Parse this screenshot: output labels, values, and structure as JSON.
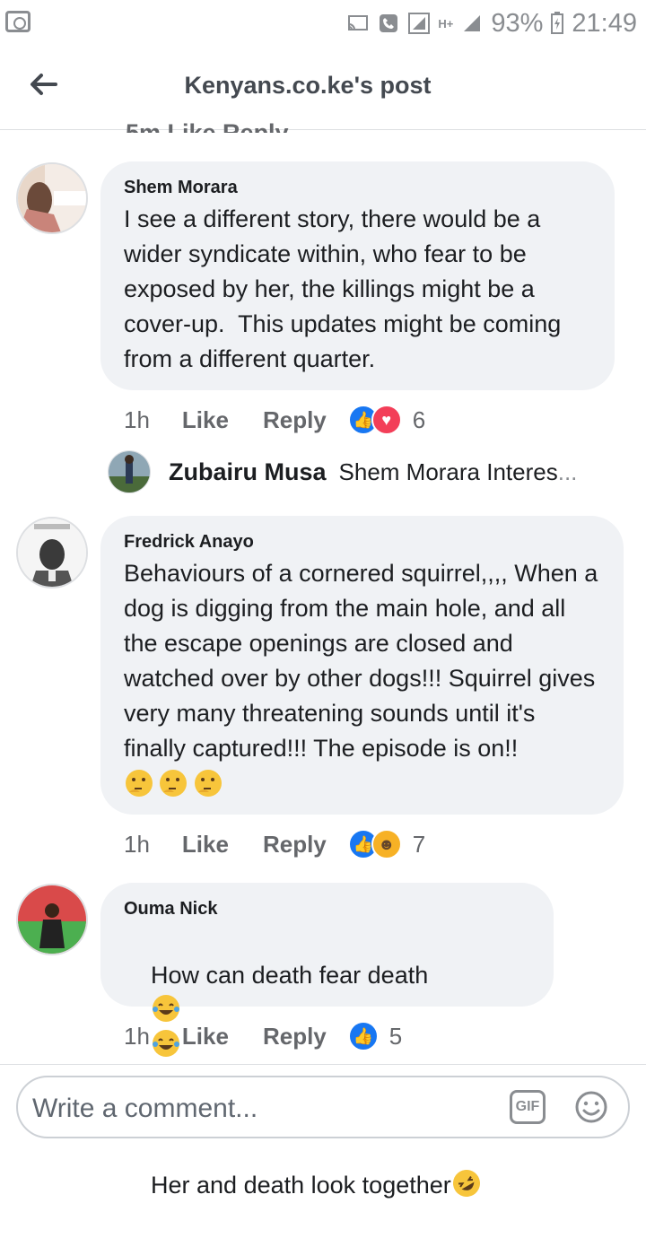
{
  "status_bar": {
    "battery": "93%",
    "time": "21:49",
    "network": "H+"
  },
  "header": {
    "title": "Kenyans.co.ke's post"
  },
  "prev_actions": "5m     Like     Reply",
  "comments": [
    {
      "author": "Shem Morara",
      "text": "I see a different story, there would be a wider syndicate within, who fear to be exposed by her, the killings might be a cover-up.  This updates might be coming from a different quarter.",
      "time": "1h",
      "like": "Like",
      "reply": "Reply",
      "reaction_count": "6"
    },
    {
      "author": "Fredrick Anayo",
      "text": "Behaviours of a cornered squirrel,,,, When a dog is digging from the main hole, and all the escape openings are closed and watched over by other dogs!!! Squirrel gives very many threatening sounds until it's finally captured!!! The episode is on!!",
      "time": "1h",
      "like": "Like",
      "reply": "Reply",
      "reaction_count": "7"
    },
    {
      "author": "Ouma Nick",
      "text_line1": "How can death fear death",
      "text_line2": "Her and death look together",
      "time": "1h",
      "like": "Like",
      "reply": "Reply",
      "reaction_count": "5"
    }
  ],
  "reply_preview": {
    "author": "Zubairu Musa",
    "snippet": "Shem Morara Interes",
    "ellipsis": "..."
  },
  "composer": {
    "placeholder": "Write a comment...",
    "gif_label": "GIF"
  },
  "colors": {
    "like_blue": "#1877f2",
    "love_red": "#f33e58",
    "bubble_bg": "#f0f2f5"
  }
}
